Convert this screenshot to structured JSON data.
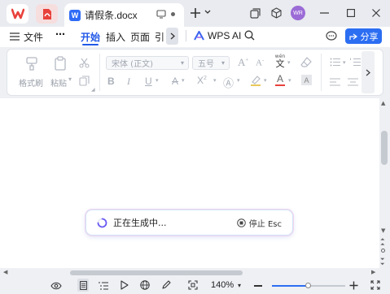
{
  "titlebar": {
    "tab_title": "请假条.docx",
    "doc_icon_letter": "W",
    "avatar_text": "WR"
  },
  "menu": {
    "file_label": "文件",
    "more_label": "⋯",
    "tabs": [
      "开始",
      "插入",
      "页面",
      "引"
    ],
    "wps_ai_label": "WPS AI",
    "share_label": "分享"
  },
  "ribbon": {
    "format_painter": "格式刷",
    "paste": "粘贴",
    "font_name": "宋体 (正文)",
    "font_size": "五号",
    "phonetic_char": "文"
  },
  "generating": {
    "text": "正在生成中...",
    "stop_label": "停止 Esc"
  },
  "statusbar": {
    "zoom": "140%"
  },
  "colors": {
    "accent": "#2c6ef2",
    "wps_red": "#e8413b"
  }
}
